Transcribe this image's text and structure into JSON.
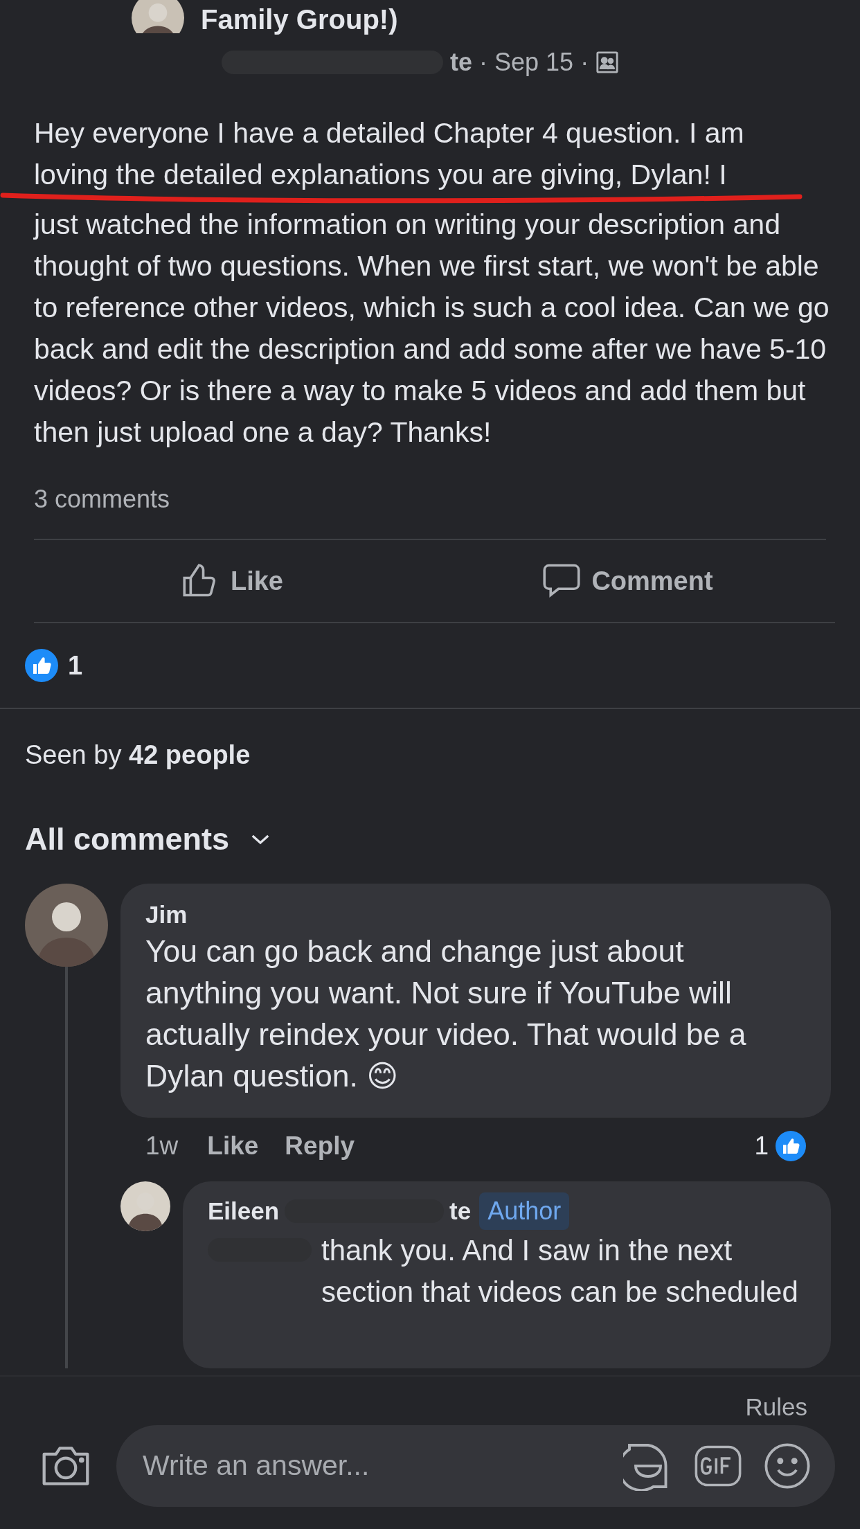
{
  "post": {
    "group_title": "Family Group!)",
    "author_tail": "te",
    "date": "Sep 15",
    "separator": "·",
    "body_underlined": "Hey everyone I have a detailed Chapter 4 question. I am loving the detailed explanations you are giving, Dylan! I",
    "body": "just watched the information on writing your description and thought of two questions. When we first start, we won't be able to reference other videos, which is such a cool idea. Can we go back and edit the description and add some after we have 5-10 videos? Or is there a way to make 5 videos and add them but then just upload one a day? Thanks!",
    "comment_count": "3 comments",
    "actions": [
      {
        "kind": "like",
        "label": "Like"
      },
      {
        "kind": "comment",
        "label": "Comment"
      }
    ],
    "reaction_count": "1",
    "seen_by": {
      "prefix": "Seen by",
      "count": "42 people"
    }
  },
  "comments_header": "All comments",
  "comments": [
    {
      "name": "Jim",
      "text": "You can go back and change just about anything you want. Not sure if YouTube will actually reindex your video. That would be a Dylan question.",
      "emoji": "😊",
      "time": "1w",
      "like": "Like",
      "reply": "Reply",
      "reaction_count": "1",
      "replies": [
        {
          "name": "Eileen",
          "name_tail": "te",
          "badge": "Author",
          "text": "thank you. And I saw in the next section that videos can be scheduled"
        }
      ]
    }
  ],
  "composer": {
    "rules": "Rules",
    "placeholder": "Write an answer..."
  }
}
